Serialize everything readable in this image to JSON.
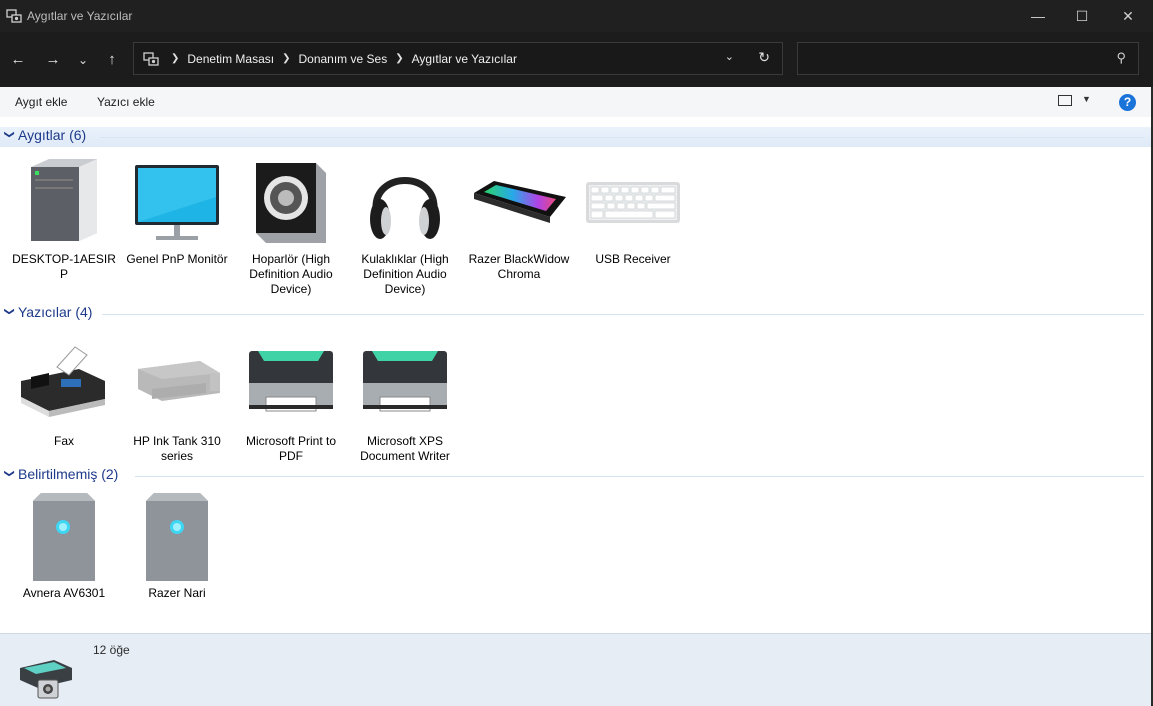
{
  "window": {
    "title": "Aygıtlar ve Yazıcılar",
    "minimize": "—",
    "maximize": "☐",
    "close": "✕"
  },
  "nav": {
    "back": "←",
    "forward": "→",
    "recent": "⌄",
    "up": "↑"
  },
  "address": {
    "crumbs": [
      "Denetim Masası",
      "Donanım ve Ses",
      "Aygıtlar ve Yazıcılar"
    ],
    "dropdown": "⌄",
    "refresh": "↻"
  },
  "search": {
    "placeholder": "",
    "icon": "⚲"
  },
  "toolbar": {
    "add_device": "Aygıt ekle",
    "add_printer": "Yazıcı ekle",
    "view_dropdown": "▼",
    "help": "?"
  },
  "groups": [
    {
      "title": "Aygıtlar (6)",
      "items": [
        {
          "label": "DESKTOP-1AESIR P",
          "icon": "desktop-computer-icon"
        },
        {
          "label": "Genel PnP Monitör",
          "icon": "monitor-icon"
        },
        {
          "label": "Hoparlör (High Definition Audio Device)",
          "icon": "speaker-icon"
        },
        {
          "label": "Kulaklıklar (High Definition Audio Device)",
          "icon": "headphones-icon"
        },
        {
          "label": "Razer BlackWidow Chroma",
          "icon": "gaming-keyboard-icon"
        },
        {
          "label": "USB Receiver",
          "icon": "keyboard-icon"
        }
      ]
    },
    {
      "title": "Yazıcılar (4)",
      "items": [
        {
          "label": "Fax",
          "icon": "fax-icon"
        },
        {
          "label": "HP Ink Tank 310 series",
          "icon": "inkjet-printer-icon"
        },
        {
          "label": "Microsoft Print to PDF",
          "icon": "printer-icon"
        },
        {
          "label": "Microsoft XPS Document Writer",
          "icon": "printer-icon"
        }
      ]
    },
    {
      "title": "Belirtilmemiş (2)",
      "items": [
        {
          "label": "Avnera AV6301",
          "icon": "generic-device-icon"
        },
        {
          "label": "Razer Nari",
          "icon": "generic-device-icon"
        }
      ]
    }
  ],
  "status": {
    "count": "12 öğe"
  },
  "colors": {
    "accent": "#1d3a8a",
    "help": "#1a73d9",
    "dark_chrome": "#202020"
  }
}
